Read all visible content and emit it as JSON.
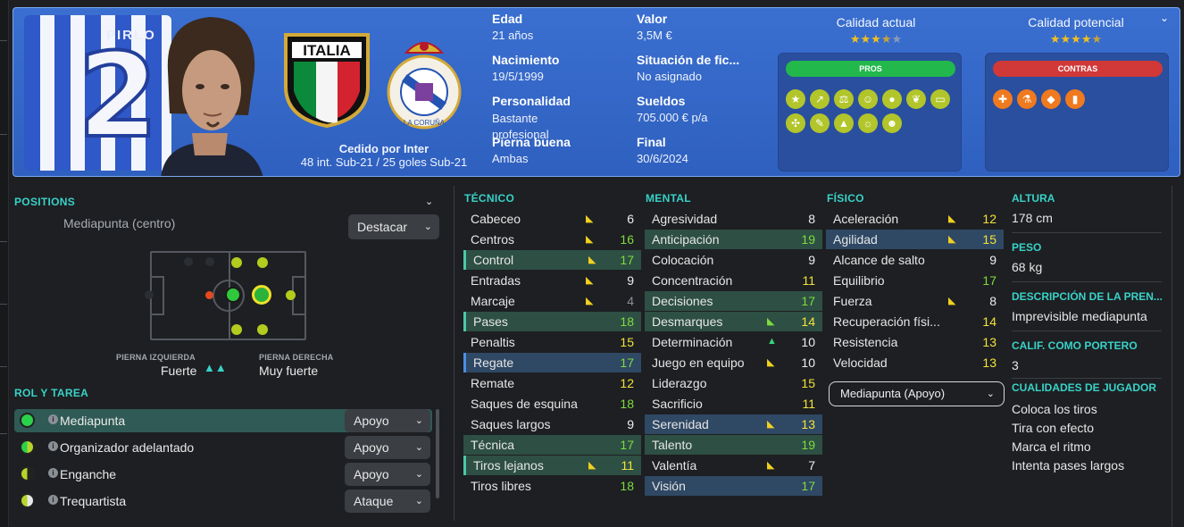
{
  "player": {
    "shirt_name": "PIRLO",
    "shirt_number": "2",
    "nation_badge": "ITALIA",
    "loan_label": "Cedido por Inter",
    "caps": "48 int. Sub-21 / 25 goles Sub-21"
  },
  "info": {
    "age_label": "Edad",
    "age": "21 años",
    "birth_label": "Nacimiento",
    "birth": "19/5/1999",
    "personality_label": "Personalidad",
    "personality": "Bastante profesional",
    "foot_label": "Pierna buena",
    "foot": "Ambas",
    "value_label": "Valor",
    "value": "3,5M €",
    "status_label": "Situación de fic...",
    "status": "No asignado",
    "wages_label": "Sueldos",
    "wages": "705.000 € p/a",
    "end_label": "Final",
    "end": "30/6/2024"
  },
  "quality": {
    "current_label": "Calidad actual",
    "current_stars": 3.5,
    "potential_label": "Calidad potencial",
    "potential_stars": 4.5,
    "pros_label": "PROS",
    "cons_label": "CONTRAS",
    "pros_icons": [
      "star-icon",
      "trend-icon",
      "weights-icon",
      "brain-icon",
      "foot-icon",
      "leaves-icon",
      "pitch-icon",
      "crosses-icon",
      "bandage-icon",
      "cone-icon",
      "bulb-icon",
      "smile-icon"
    ],
    "cons_icons": [
      "injury-icon",
      "flask-icon",
      "tag-icon",
      "cards-icon"
    ],
    "pros_color": "#1fb84a",
    "cons_color": "#d23a3a"
  },
  "positions": {
    "title": "POSITIONS",
    "position": "Mediapunta (centro)",
    "highlight": "Destacar",
    "left_foot_label": "PIERNA IZQUIERDA",
    "left_foot": "Fuerte",
    "right_foot_label": "PIERNA DERECHA",
    "right_foot": "Muy fuerte"
  },
  "roles": {
    "title": "ROL Y TAREA",
    "items": [
      {
        "name": "Mediapunta",
        "duty": "Apoyo"
      },
      {
        "name": "Organizador adelantado",
        "duty": "Apoyo"
      },
      {
        "name": "Enganche",
        "duty": "Apoyo"
      },
      {
        "name": "Trequartista",
        "duty": "Ataque"
      }
    ]
  },
  "attributes": {
    "technical_title": "TÉCNICO",
    "mental_title": "MENTAL",
    "physical_title": "FÍSICO",
    "technical": [
      {
        "name": "Cabeceo",
        "value": "6"
      },
      {
        "name": "Centros",
        "value": "16"
      },
      {
        "name": "Control",
        "value": "17"
      },
      {
        "name": "Entradas",
        "value": "9"
      },
      {
        "name": "Marcaje",
        "value": "4"
      },
      {
        "name": "Pases",
        "value": "18"
      },
      {
        "name": "Penaltis",
        "value": "15"
      },
      {
        "name": "Regate",
        "value": "17"
      },
      {
        "name": "Remate",
        "value": "12"
      },
      {
        "name": "Saques de esquina",
        "value": "18"
      },
      {
        "name": "Saques largos",
        "value": "9"
      },
      {
        "name": "Técnica",
        "value": "17"
      },
      {
        "name": "Tiros lejanos",
        "value": "11"
      },
      {
        "name": "Tiros libres",
        "value": "18"
      }
    ],
    "mental": [
      {
        "name": "Agresividad",
        "value": "8"
      },
      {
        "name": "Anticipación",
        "value": "19"
      },
      {
        "name": "Colocación",
        "value": "9"
      },
      {
        "name": "Concentración",
        "value": "11"
      },
      {
        "name": "Decisiones",
        "value": "17"
      },
      {
        "name": "Desmarques",
        "value": "14"
      },
      {
        "name": "Determinación",
        "value": "10"
      },
      {
        "name": "Juego en equipo",
        "value": "10"
      },
      {
        "name": "Liderazgo",
        "value": "15"
      },
      {
        "name": "Sacrificio",
        "value": "11"
      },
      {
        "name": "Serenidad",
        "value": "13"
      },
      {
        "name": "Talento",
        "value": "19"
      },
      {
        "name": "Valentía",
        "value": "7"
      },
      {
        "name": "Visión",
        "value": "17"
      }
    ],
    "physical": [
      {
        "name": "Aceleración",
        "value": "12"
      },
      {
        "name": "Agilidad",
        "value": "15"
      },
      {
        "name": "Alcance de salto",
        "value": "9"
      },
      {
        "name": "Equilibrio",
        "value": "17"
      },
      {
        "name": "Fuerza",
        "value": "8"
      },
      {
        "name": "Recuperación físi...",
        "value": "14"
      },
      {
        "name": "Resistencia",
        "value": "13"
      },
      {
        "name": "Velocidad",
        "value": "13"
      }
    ],
    "role_select": "Mediapunta (Apoyo)"
  },
  "details": {
    "height_label": "ALTURA",
    "height": "178 cm",
    "weight_label": "PESO",
    "weight": "68 kg",
    "press_label": "DESCRIPCIÓN DE LA PREN...",
    "press": "Imprevisible mediapunta",
    "gk_label": "CALIF. COMO PORTERO",
    "gk": "3",
    "traits_label": "CUALIDADES DE JUGADOR",
    "traits": [
      "Coloca los tiros",
      "Tira con efecto",
      "Marca el ritmo",
      "Intenta pases largos"
    ]
  }
}
